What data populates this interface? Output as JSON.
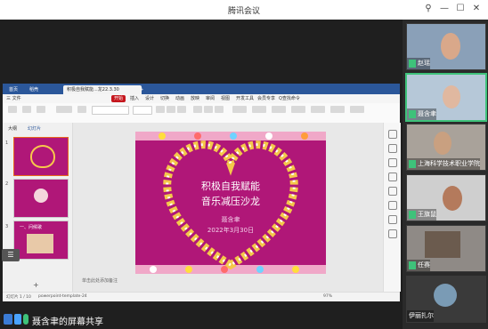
{
  "window": {
    "title": "腾讯会议"
  },
  "wps": {
    "tabs": [
      "首页",
      "稻壳",
      "积极自我赋能...龙22.3.30"
    ],
    "menus": [
      "三 文件",
      "开始",
      "插入",
      "设计",
      "切换",
      "动画",
      "放映",
      "审阅",
      "视图",
      "开发工具",
      "会员专享",
      "Q查找命令"
    ],
    "panel_tabs": [
      "大纲",
      "幻灯片"
    ],
    "thumbs": [
      "1",
      "2",
      "3"
    ],
    "slide_notes": "单击此处添加备注",
    "status": {
      "page": "幻灯片 1 / 10",
      "template": "powerpoint-template-24",
      "zoom": "97%"
    }
  },
  "slide": {
    "line1": "积极自我赋能",
    "line2": "音乐减压沙龙",
    "name": "聂含聿",
    "date": "2022年3月30日"
  },
  "thumb3_label": "一、问候歌",
  "share_label": "聂含聿的屏幕共享",
  "participants": [
    "赵瑶",
    "聂含聿",
    "上海科学技术职业学院",
    "王旗鼠",
    "任赛",
    "伊丽扎尔"
  ],
  "colors": {
    "accent": "#3ec27a",
    "slide_bg": "#b01778",
    "wps_blue": "#2b579a"
  }
}
